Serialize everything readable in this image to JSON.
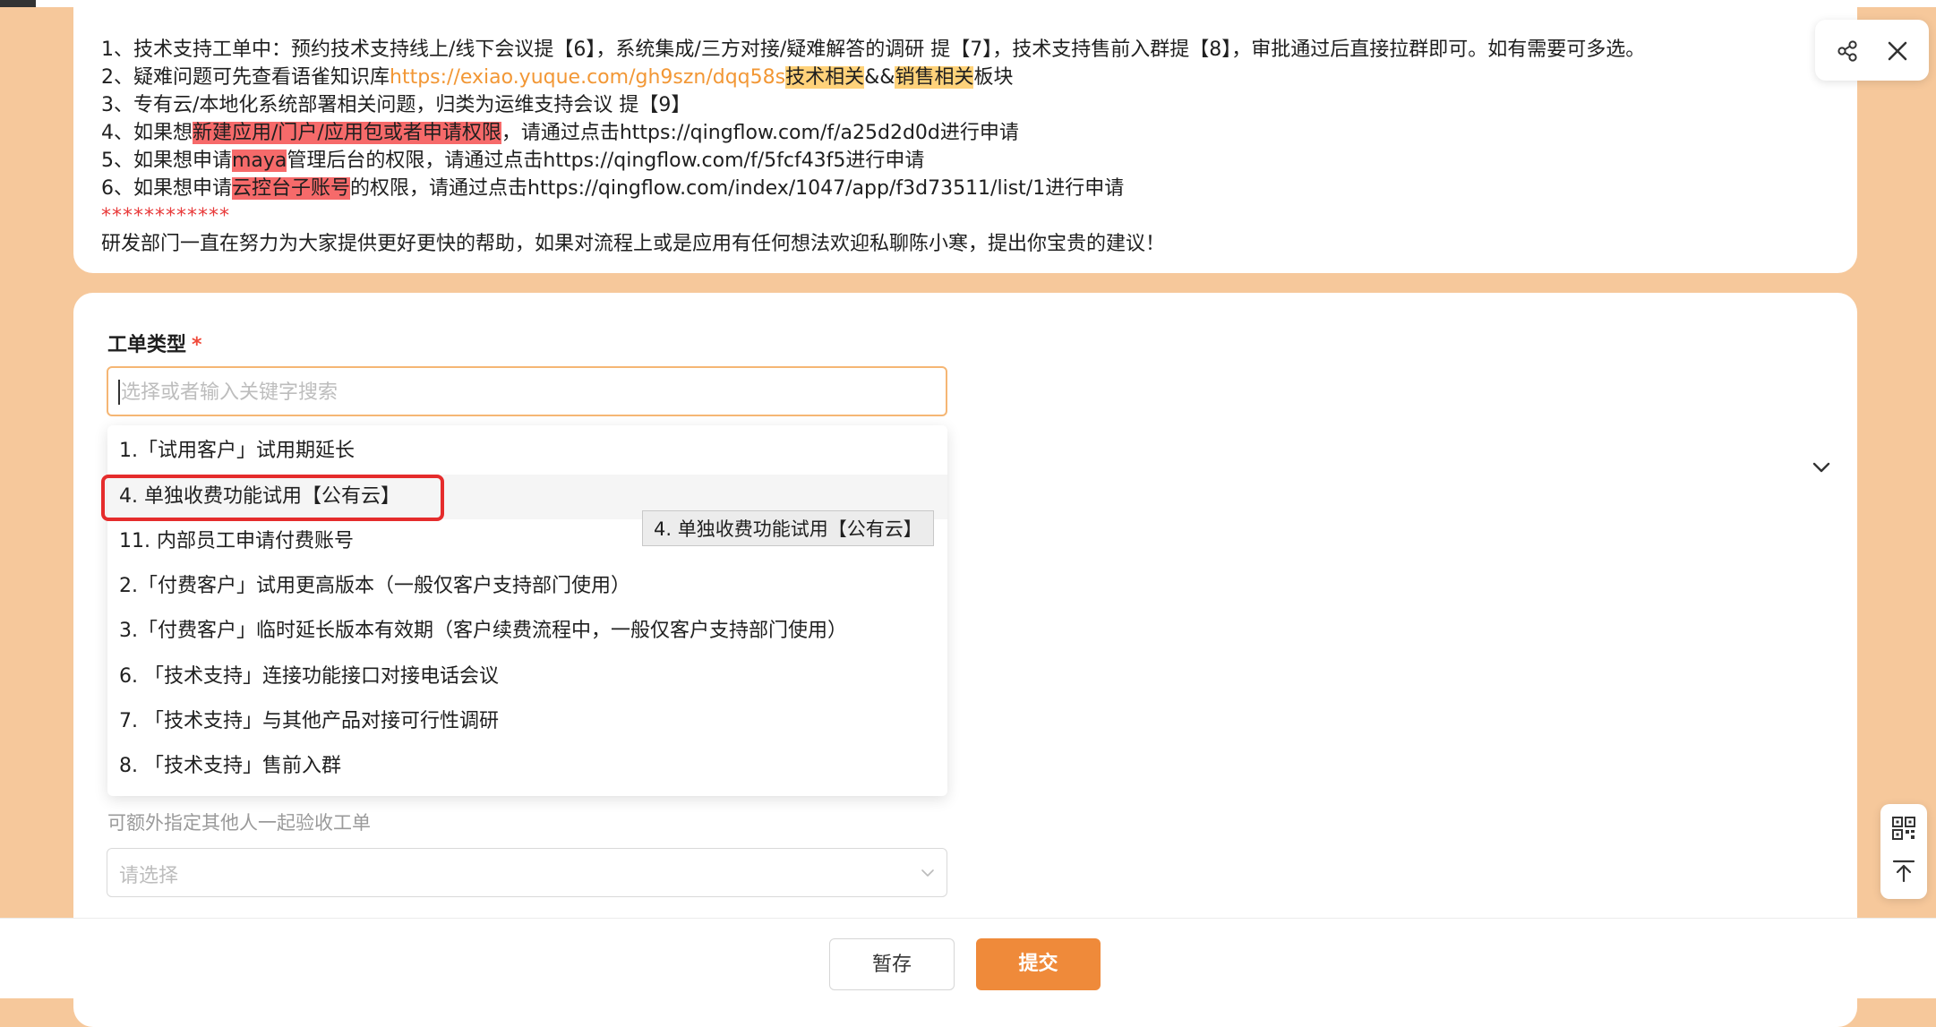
{
  "notes": {
    "line1": "1、技术支持工单中：预约技术支持线上/线下会议提【6】，系统集成/三方对接/疑难解答的调研 提【7】，技术支持售前入群提【8】，审批通过后直接拉群即可。如有需要可多选。",
    "line2_prefix": "2、疑难问题可先查看语雀知识库",
    "line2_link": "https://exiao.yuque.com/gh9szn/dqq58s",
    "line2_hl1": "技术相关",
    "line2_amp": "&&",
    "line2_hl2": "销售相关",
    "line2_suffix": "板块",
    "line3": "3、专有云/本地化系统部署相关问题，归类为运维支持会议 提【9】",
    "line4_prefix": "4、如果想",
    "line4_hl": "新建应用/门户/应用包或者申请权限",
    "line4_suffix": "，请通过点击https://qingflow.com/f/a25d2d0d进行申请",
    "line5_prefix": "5、如果想申请",
    "line5_hl": "maya",
    "line5_suffix": "管理后台的权限，请通过点击https://qingflow.com/f/5fcf43f5进行申请",
    "line6_prefix": "6、如果想申请",
    "line6_hl": "云控台子账号",
    "line6_suffix": "的权限，请通过点击https://qingflow.com/index/1047/app/f3d73511/list/1进行申请",
    "stars": "************",
    "closing": "研发部门一直在努力为大家提供更好更快的帮助，如果对流程上或是应用有任何想法欢迎私聊陈小寒，提出你宝贵的建议！"
  },
  "form": {
    "field_label": "工单类型",
    "required_mark": "*",
    "search_placeholder": "选择或者输入关键字搜索",
    "options": [
      "1.「试用客户」试用期延长",
      "4. 单独收费功能试用【公有云】",
      "11. 内部员工申请付费账号",
      "2.「付费客户」试用更高版本（一般仅客户支持部门使用）",
      "3.「付费客户」临时延长版本有效期（客户续费流程中，一般仅客户支持部门使用）",
      "6. 「技术支持」连接功能接口对接电话会议",
      "7. 「技术支持」与其他产品对接可行性调研",
      "8. 「技术支持」售前入群"
    ],
    "tooltip": "4. 单独收费功能试用【公有云】",
    "extra_label": "可额外指定其他人一起验收工单",
    "select_placeholder": "请选择"
  },
  "footer": {
    "save_label": "暂存",
    "submit_label": "提交"
  },
  "colors": {
    "background": "#f6c89b",
    "accent": "#ef8a3a",
    "link": "#f29735",
    "highlight_yellow": "#ffd27a",
    "highlight_red": "#f66a6a",
    "selection_box": "#e52c2c"
  },
  "icons": [
    "share-icon",
    "close-icon",
    "chevron-down-icon",
    "qrcode-icon",
    "back-to-top-icon"
  ]
}
